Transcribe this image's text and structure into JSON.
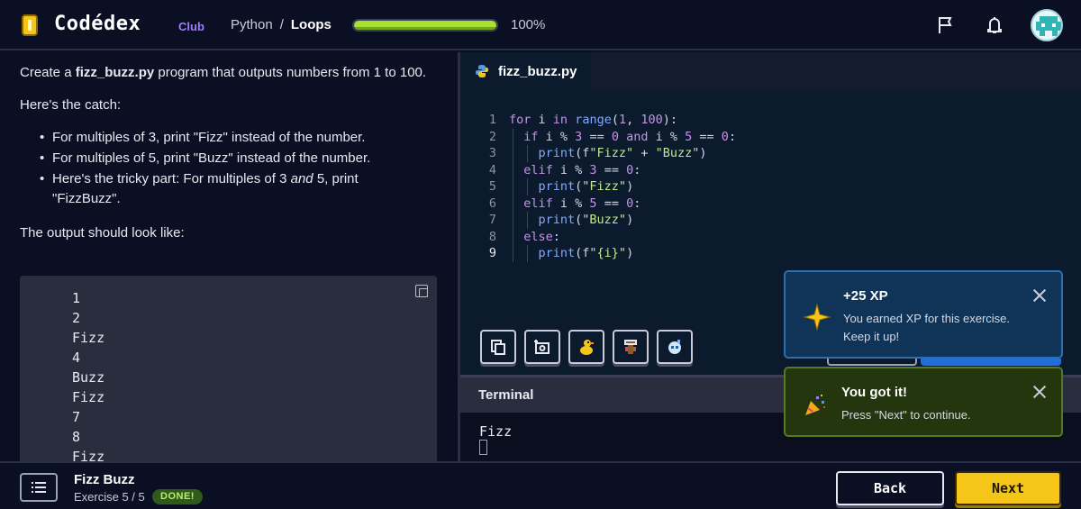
{
  "header": {
    "logo": "Codédex",
    "logo_badge": "Club",
    "breadcrumb": {
      "course": "Python",
      "separator": "/",
      "chapter": "Loops"
    },
    "progress": {
      "value": 1.0,
      "label": "100%"
    },
    "icons": [
      "flag-icon",
      "bell-icon",
      "avatar"
    ]
  },
  "lesson": {
    "intro_pre": "Create a ",
    "intro_file": "fizz_buzz.py",
    "intro_post": " program that outputs numbers from 1 to 100.",
    "catch": "Here's the catch:",
    "rules": [
      "For multiples of 3, print \"Fizz\" instead of the number.",
      "For multiples of 5, print \"Buzz\" instead of the number."
    ],
    "rule3_pre": "Here's the tricky part: For multiples of 3 ",
    "rule3_em": "and",
    "rule3_post": " 5, print \"FizzBuzz\".",
    "output_label": "The output should look like:",
    "output_lines": [
      "1",
      "2",
      "Fizz",
      "4",
      "Buzz",
      "Fizz",
      "7",
      "8",
      "Fizz"
    ]
  },
  "editor": {
    "tab_name": "fizz_buzz.py",
    "line_numbers": [
      "1",
      "2",
      "3",
      "4",
      "5",
      "6",
      "7",
      "8",
      "9"
    ],
    "toolbar_icons": [
      "copy-icon",
      "screenshot-icon",
      "rubber-duck-icon",
      "dev-tools-icon",
      "assistant-icon"
    ]
  },
  "terminal": {
    "title": "Terminal",
    "output": "Fizz"
  },
  "toasts": {
    "xp": {
      "title": "+25 XP",
      "message": "You earned XP for this exercise. Keep it up!"
    },
    "win": {
      "title": "You got it!",
      "message": "Press \"Next\" to continue."
    }
  },
  "footer": {
    "exercise_title": "Fizz Buzz",
    "exercise_sub": "Exercise 5 / 5",
    "status": "DONE!",
    "back_label": "Back",
    "next_label": "Next"
  },
  "colors": {
    "accent_yellow": "#f5c518",
    "progress_green": "#a6e22e",
    "club_purple": "#a57cff",
    "xp_toast_bg": "#103457",
    "win_toast_bg": "#24360e"
  }
}
